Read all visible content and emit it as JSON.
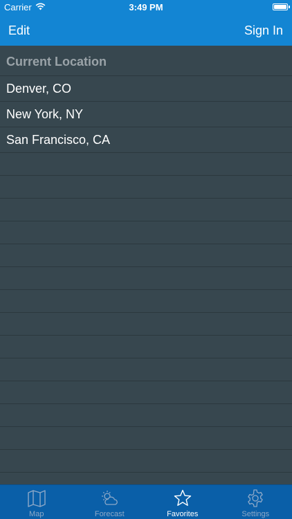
{
  "status_bar": {
    "carrier": "Carrier",
    "time": "3:49 PM"
  },
  "navbar": {
    "left_button": "Edit",
    "right_button": "Sign In",
    "background": "#1385d3"
  },
  "favorites": {
    "section_header": "Current Location",
    "items": [
      {
        "label": "Denver, CO"
      },
      {
        "label": "New York, NY"
      },
      {
        "label": "San Francisco, CA"
      }
    ]
  },
  "tabbar": {
    "background": "#0a5fa8",
    "active_index": 2,
    "tabs": [
      {
        "label": "Map",
        "icon": "map-icon"
      },
      {
        "label": "Forecast",
        "icon": "forecast-icon"
      },
      {
        "label": "Favorites",
        "icon": "star-icon"
      },
      {
        "label": "Settings",
        "icon": "gear-icon"
      }
    ]
  }
}
